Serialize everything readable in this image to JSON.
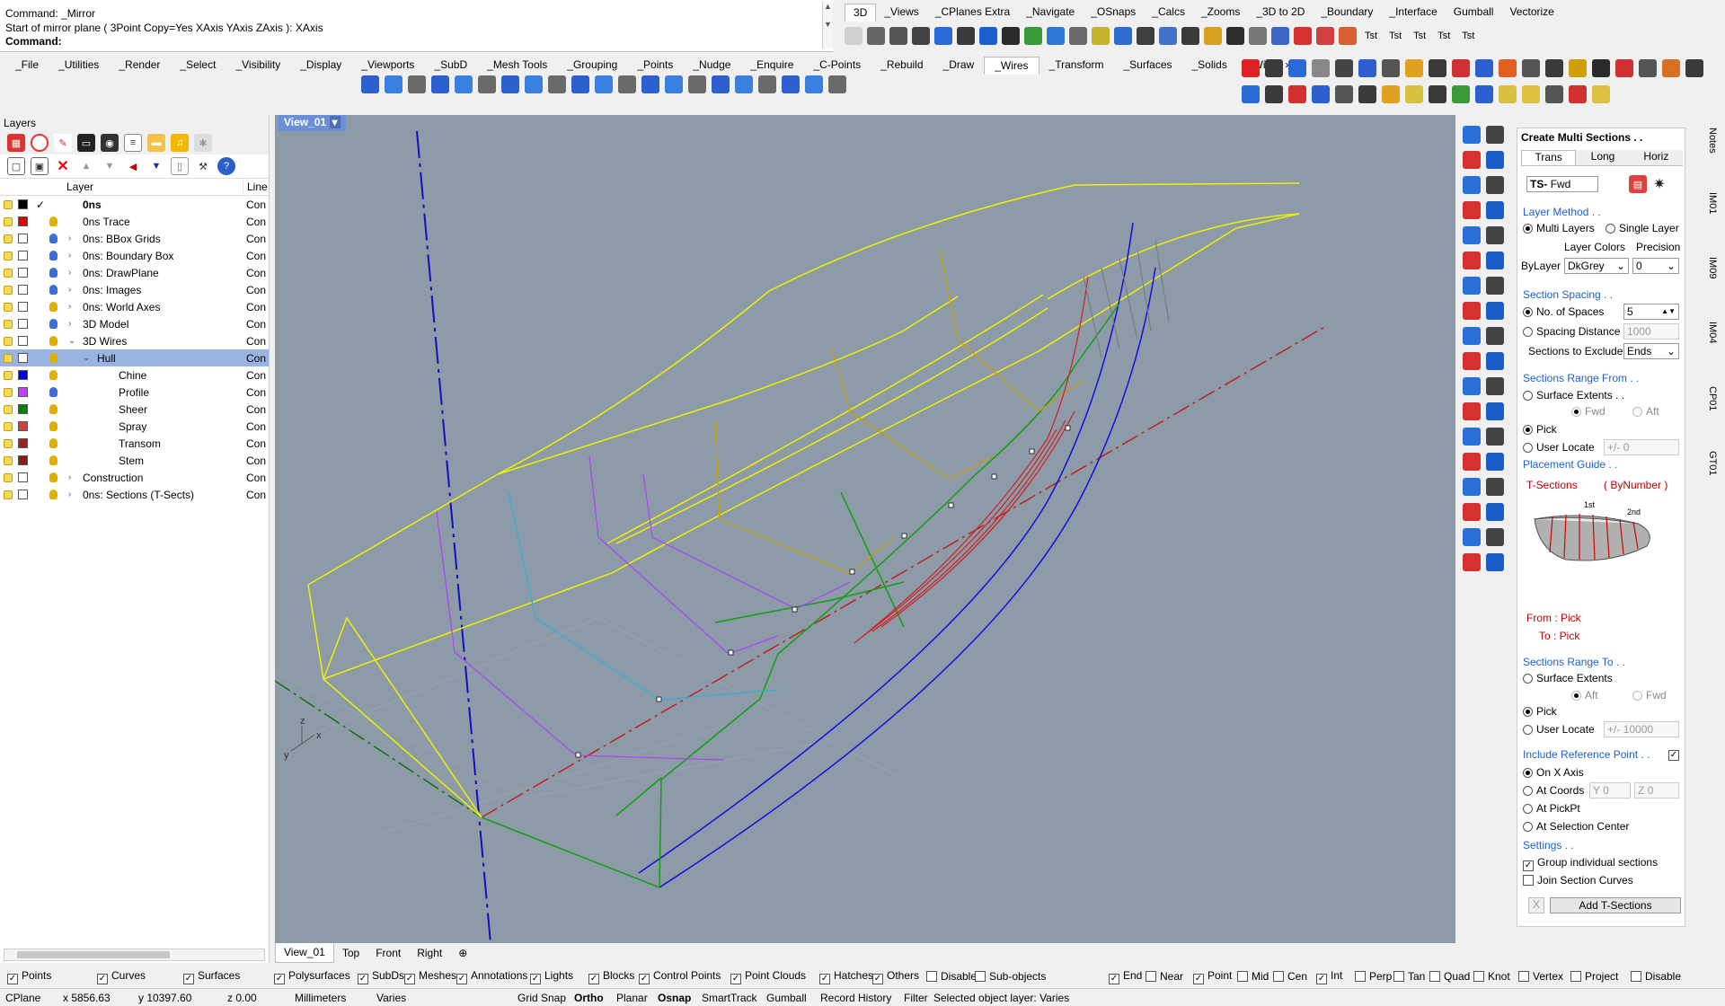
{
  "command": {
    "line1": "Command: _Mirror",
    "line2": "Start of mirror plane ( 3Point  Copy=Yes  XAxis  YAxis  ZAxis ): XAxis",
    "prompt": "Command:"
  },
  "top_tabs": [
    "3D",
    "_Views",
    "_CPlanes Extra",
    "_Navigate",
    "_OSnaps",
    "_Calcs",
    "_Zooms",
    "_3D to 2D",
    "_Boundary",
    "_Interface",
    "Gumball",
    "Vectorize"
  ],
  "main_tabs": [
    "_File",
    "_Utilities",
    "_Render",
    "_Select",
    "_Visibility",
    "_Display",
    "_Viewports",
    "_SubD",
    "_Mesh Tools",
    "_Grouping",
    "_Points",
    "_Nudge",
    "_Enquire",
    "_C-Points",
    "_Rebuild",
    "_Draw",
    "_Wires",
    "_Transform",
    "_Surfaces",
    "_Solids",
    "_Wi"
  ],
  "main_tabs_more": "»",
  "tst_labels": [
    "Tst",
    "Tst",
    "Tst",
    "Tst",
    "Tst"
  ],
  "layers": {
    "panel_title": "Layers",
    "col_layer": "Layer",
    "col_line": "Line",
    "rows": [
      {
        "name": "0ns",
        "color": "#000000",
        "bulb": "none",
        "indent": 0,
        "expand": "",
        "lt": "Con",
        "current": true,
        "bold": true
      },
      {
        "name": "0ns Trace",
        "color": "#e00000",
        "bulb": "#e0b000",
        "indent": 0,
        "expand": "",
        "lt": "Con"
      },
      {
        "name": "0ns: BBox Grids",
        "color": "#ffffff",
        "bulb": "#3a6fd8",
        "indent": 0,
        "expand": "›",
        "lt": "Con"
      },
      {
        "name": "0ns: Boundary Box",
        "color": "#ffffff",
        "bulb": "#3a6fd8",
        "indent": 0,
        "expand": "›",
        "lt": "Con"
      },
      {
        "name": "0ns: DrawPlane",
        "color": "#ffffff",
        "bulb": "#3a6fd8",
        "indent": 0,
        "expand": "›",
        "lt": "Con"
      },
      {
        "name": "0ns: Images",
        "color": "#ffffff",
        "bulb": "#3a6fd8",
        "indent": 0,
        "expand": "›",
        "lt": "Con"
      },
      {
        "name": "0ns: World Axes",
        "color": "#ffffff",
        "bulb": "#e0b000",
        "indent": 0,
        "expand": "›",
        "lt": "Con"
      },
      {
        "name": "3D Model",
        "color": "#ffffff",
        "bulb": "#3a6fd8",
        "indent": 0,
        "expand": "›",
        "lt": "Con"
      },
      {
        "name": "3D Wires",
        "color": "#ffffff",
        "bulb": "#e0b000",
        "indent": 0,
        "expand": "⌄",
        "lt": "Con"
      },
      {
        "name": "Hull",
        "color": "#ffffff",
        "bulb": "#e0b000",
        "indent": 1,
        "expand": "⌄",
        "lt": "Con",
        "selected": true
      },
      {
        "name": "Chine",
        "color": "#0000e0",
        "bulb": "#e0b000",
        "indent": 2,
        "expand": "",
        "lt": "Con"
      },
      {
        "name": "Profile",
        "color": "#c040ff",
        "bulb": "#3a6fd8",
        "indent": 2,
        "expand": "",
        "lt": "Con"
      },
      {
        "name": "Sheer",
        "color": "#008000",
        "bulb": "#e0b000",
        "indent": 2,
        "expand": "",
        "lt": "Con"
      },
      {
        "name": "Spray",
        "color": "#d04040",
        "bulb": "#e0b000",
        "indent": 2,
        "expand": "",
        "lt": "Con"
      },
      {
        "name": "Transom",
        "color": "#a02020",
        "bulb": "#e0b000",
        "indent": 2,
        "expand": "",
        "lt": "Con"
      },
      {
        "name": "Stem",
        "color": "#8b1a1a",
        "bulb": "#e0b000",
        "indent": 2,
        "expand": "",
        "lt": "Con"
      },
      {
        "name": "Construction",
        "color": "#ffffff",
        "bulb": "#e0b000",
        "indent": 0,
        "expand": "›",
        "lt": "Con"
      },
      {
        "name": "0ns: Sections (T-Sects)",
        "color": "#ffffff",
        "bulb": "#e0b000",
        "indent": 0,
        "expand": "›",
        "lt": "Con"
      }
    ]
  },
  "viewport": {
    "title": "View_01",
    "tabs": [
      "View_01",
      "Top",
      "Front",
      "Right"
    ],
    "axis_z": "z",
    "axis_y": "y",
    "axis_x": "x"
  },
  "sections_panel": {
    "title": "Create Multi Sections . .",
    "tabs": [
      "Trans",
      "Long",
      "Horiz"
    ],
    "prefix": "TS-",
    "prefix_value": "Fwd",
    "layer_method": "Layer Method . .",
    "multi_layers": "Multi Layers",
    "single_layer": "Single Layer",
    "layer_colors": "Layer Colors",
    "precision": "Precision",
    "bylayer": "ByLayer",
    "bylayer_value": "DkGrey",
    "precision_value": "0",
    "section_spacing": "Section Spacing . .",
    "no_of_spaces": "No. of Spaces",
    "no_of_spaces_value": "5",
    "spacing_distance": "Spacing Distance",
    "spacing_distance_value": "1000",
    "sections_to_exclude": "Sections to Exclude",
    "exclude_value": "Ends",
    "range_from": "Sections Range From . .",
    "surface_extents": "Surface Extents . .",
    "fwd": "Fwd",
    "aft": "Aft",
    "pick": "Pick",
    "user_locate": "User Locate",
    "plusminus": "+/-",
    "from_value": "0",
    "placement_guide": "Placement Guide . .",
    "t_sections": "T-Sections",
    "by_number": "( ByNumber )",
    "first": "1st",
    "second": "2nd",
    "from_pick": "From : Pick",
    "to_pick": "To : Pick",
    "range_to": "Sections Range To . .",
    "surface_extents2": "Surface Extents",
    "to_value": "10000",
    "include_ref": "Include Reference Point . .",
    "on_x_axis": "On X Axis",
    "at_coords": "At Coords",
    "coord_y_label": "Y",
    "coord_y": "0",
    "coord_z_label": "Z",
    "coord_z": "0",
    "at_pickpt": "At PickPt",
    "at_selection_center": "At Selection Center",
    "settings": "Settings . .",
    "group_individual": "Group individual sections",
    "join_section_curves": "Join Section Curves",
    "close_x": "X",
    "add_button": "Add T-Sections"
  },
  "right_strip": [
    "Notes",
    "IM01",
    "IM09",
    "IM04",
    "CP01",
    "GT01"
  ],
  "filter_bar": {
    "items": [
      {
        "label": "Points",
        "checked": true
      },
      {
        "label": "Curves",
        "checked": true
      },
      {
        "label": "Surfaces",
        "checked": true
      },
      {
        "label": "Polysurfaces",
        "checked": true
      },
      {
        "label": "SubDs",
        "checked": true
      },
      {
        "label": "Meshes",
        "checked": true
      },
      {
        "label": "Annotations",
        "checked": true
      },
      {
        "label": "Lights",
        "checked": true
      },
      {
        "label": "Blocks",
        "checked": true
      },
      {
        "label": "Control Points",
        "checked": true
      },
      {
        "label": "Point Clouds",
        "checked": true
      },
      {
        "label": "Hatches",
        "checked": true
      },
      {
        "label": "Others",
        "checked": true
      },
      {
        "label": "Disable",
        "checked": false
      },
      {
        "label": "Sub-objects",
        "checked": false
      }
    ],
    "osnaps": [
      {
        "label": "End",
        "checked": true
      },
      {
        "label": "Near",
        "checked": false
      },
      {
        "label": "Point",
        "checked": true
      },
      {
        "label": "Mid",
        "checked": false
      },
      {
        "label": "Cen",
        "checked": false
      },
      {
        "label": "Int",
        "checked": true
      },
      {
        "label": "Perp",
        "checked": false
      },
      {
        "label": "Tan",
        "checked": false
      },
      {
        "label": "Quad",
        "checked": false
      },
      {
        "label": "Knot",
        "checked": false
      },
      {
        "label": "Vertex",
        "checked": false
      },
      {
        "label": "Project",
        "checked": false
      },
      {
        "label": "Disable",
        "checked": false
      }
    ]
  },
  "status": {
    "cplane": "CPlane",
    "x": "x 5856.63",
    "y": "y 10397.60",
    "z": "z 0.00",
    "units": "Millimeters",
    "layer": "Varies",
    "grid_snap": "Grid Snap",
    "ortho": "Ortho",
    "planar": "Planar",
    "osnap": "Osnap",
    "smarttrack": "SmartTrack",
    "gumball": "Gumball",
    "record_history": "Record History",
    "filter": "Filter",
    "message": "Selected object layer: Varies"
  }
}
